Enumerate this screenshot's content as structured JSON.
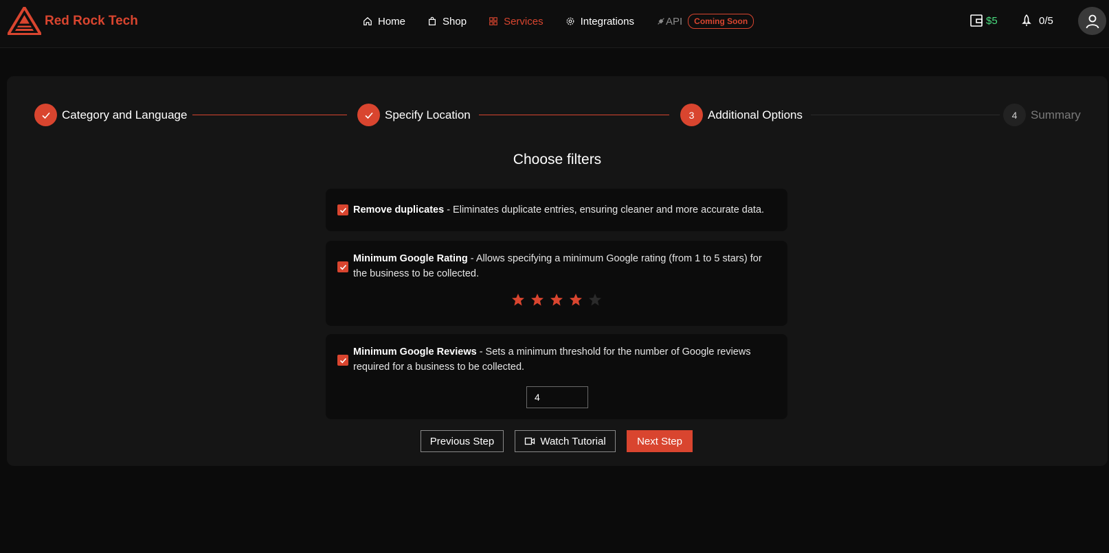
{
  "colors": {
    "accent": "#d9452f",
    "balance": "#4ade80",
    "background": "#0b0b0b",
    "card": "#151515"
  },
  "header": {
    "brand": "Red Rock Tech",
    "nav": [
      {
        "label": "Home",
        "icon": "home-icon"
      },
      {
        "label": "Shop",
        "icon": "shopping-bag-icon"
      },
      {
        "label": "Services",
        "icon": "grid-icon",
        "active": true
      },
      {
        "label": "Integrations",
        "icon": "gear-icon"
      },
      {
        "label": "API",
        "icon": "plug-icon"
      }
    ],
    "api_badge": "Coming Soon",
    "balance": "$5",
    "notifications": "0/5"
  },
  "stepper": [
    {
      "index": "1",
      "label": "Category and Language",
      "state": "done"
    },
    {
      "index": "2",
      "label": "Specify Location",
      "state": "done"
    },
    {
      "index": "3",
      "label": "Additional Options",
      "state": "current"
    },
    {
      "index": "4",
      "label": "Summary",
      "state": "pending"
    }
  ],
  "section_title": "Choose filters",
  "filters": {
    "duplicates": {
      "checked": true,
      "title": "Remove duplicates",
      "description": " - Eliminates duplicate entries, ensuring cleaner and more accurate data."
    },
    "rating": {
      "checked": true,
      "title": "Minimum Google Rating",
      "description": " - Allows specifying a minimum Google rating (from 1 to 5 stars) for the business to be collected.",
      "stars_selected": 4,
      "stars_max": 5
    },
    "reviews": {
      "checked": true,
      "title": "Minimum Google Reviews",
      "description": " - Sets a minimum threshold for the number of Google reviews required for a business to be collected.",
      "value": "4"
    }
  },
  "buttons": {
    "previous": "Previous Step",
    "tutorial": "Watch Tutorial",
    "next": "Next Step"
  }
}
